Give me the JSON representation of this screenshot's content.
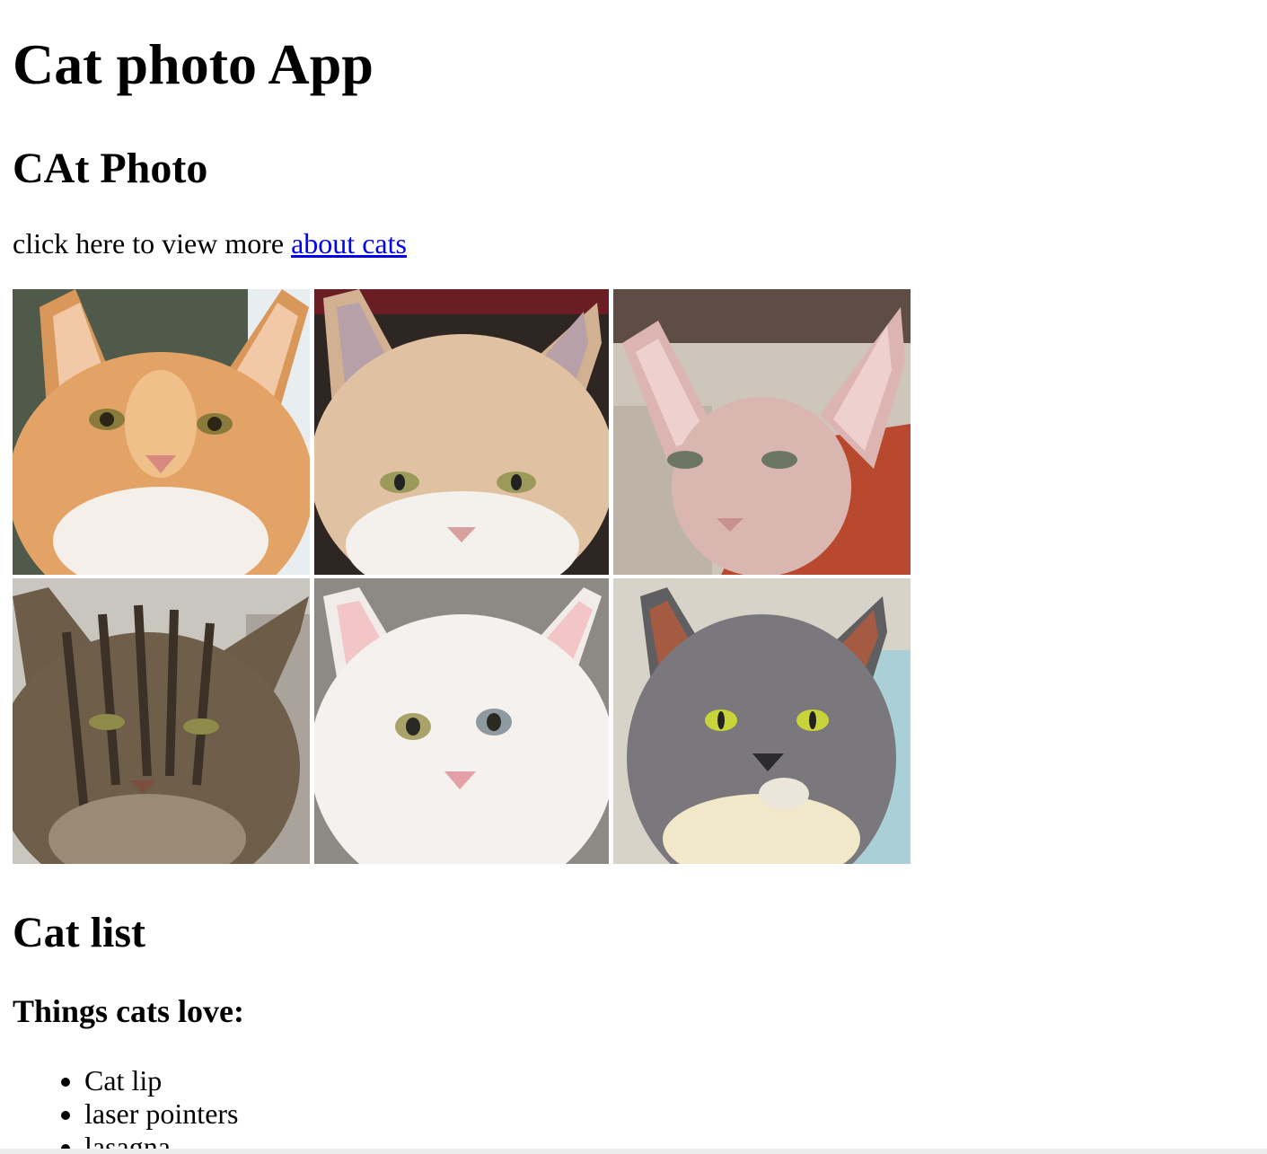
{
  "header": {
    "title": "Cat photo App"
  },
  "photo_section": {
    "title": "CAt Photo",
    "intro_text": "click here to view more ",
    "link_text": "about cats"
  },
  "gallery": {
    "photos": [
      {
        "name": "orange-tabby-cat-photo"
      },
      {
        "name": "cream-cat-photo"
      },
      {
        "name": "sphynx-cat-photo"
      },
      {
        "name": "brown-tabby-cat-photo"
      },
      {
        "name": "white-persian-cat-photo"
      },
      {
        "name": "grey-white-cat-photo"
      }
    ]
  },
  "list_section": {
    "title": "Cat list",
    "subtitle": "Things cats love:",
    "items": [
      "Cat lip",
      "laser pointers",
      "lasagna"
    ]
  },
  "colors": {
    "link": "#0000ee"
  }
}
